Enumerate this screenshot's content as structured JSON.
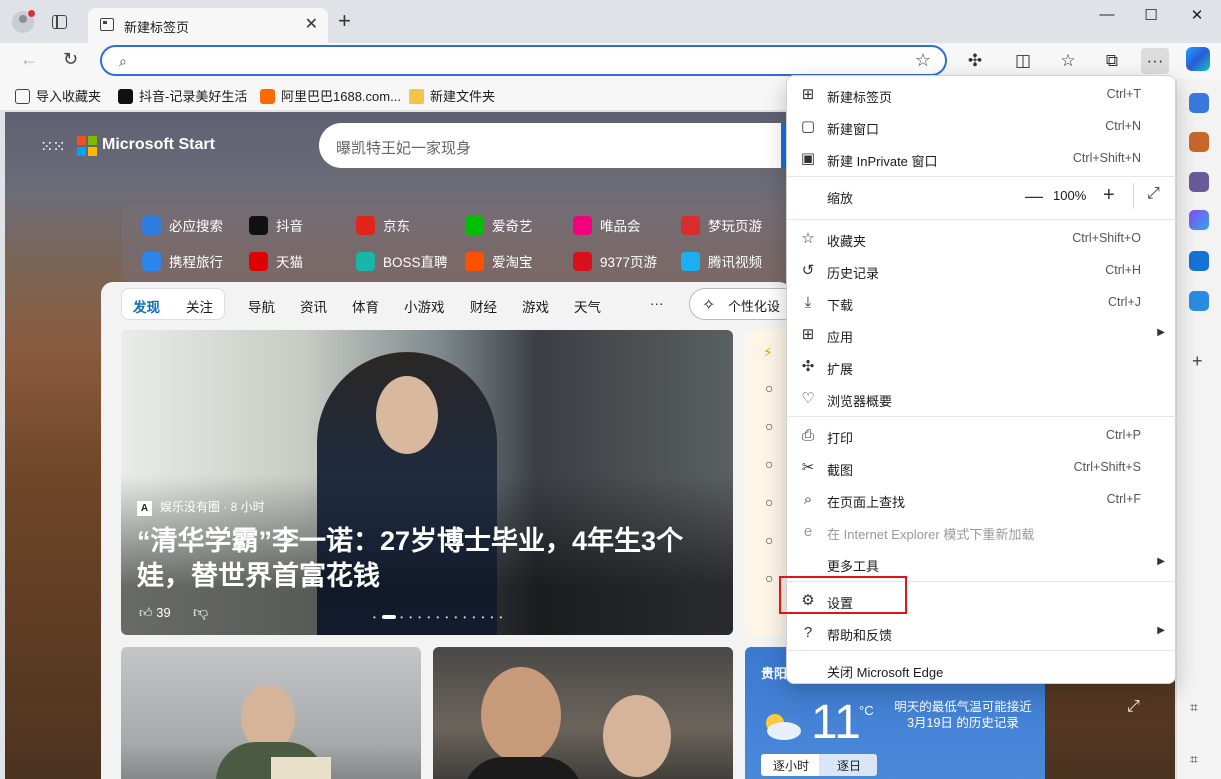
{
  "tab": {
    "title": "新建标签页"
  },
  "omnibox": {
    "value": ""
  },
  "favorites": [
    "导入收藏夹",
    "抖音-记录美好生活",
    "阿里巴巴1688.com...",
    "新建文件夹"
  ],
  "content": {
    "brand": "Microsoft Start",
    "search_placeholder": "曝凯特王妃一家现身",
    "quicklinks": [
      {
        "label": "必应搜索",
        "icon": "bing",
        "color": "#2f7de1"
      },
      {
        "label": "抖音",
        "icon": "douyin",
        "color": "#111111"
      },
      {
        "label": "京东",
        "icon": "jd",
        "color": "#e1251b"
      },
      {
        "label": "爱奇艺",
        "icon": "iqiyi",
        "color": "#00be06"
      },
      {
        "label": "唯品会",
        "icon": "vip",
        "color": "#f10180"
      },
      {
        "label": "梦玩页游",
        "icon": "mengwan",
        "color": "#d92d2d"
      },
      {
        "label": "携程旅行",
        "icon": "ctrip",
        "color": "#2a86e8"
      },
      {
        "label": "天猫",
        "icon": "tmall",
        "color": "#e00000"
      },
      {
        "label": "BOSS直聘",
        "icon": "boss",
        "color": "#16b6a8"
      },
      {
        "label": "爱淘宝",
        "icon": "taobao",
        "color": "#ff5000"
      },
      {
        "label": "9377页游",
        "icon": "9377",
        "color": "#d9101c"
      },
      {
        "label": "腾讯视频",
        "icon": "tencent-video",
        "color": "#1bb0f0"
      }
    ],
    "feed_tabs": [
      "发现",
      "关注",
      "导航",
      "资讯",
      "体育",
      "小游戏",
      "财经",
      "游戏",
      "天气",
      "···"
    ],
    "personalize": "个性化设",
    "hero": {
      "source": "娱乐没有圈 · 8 小时",
      "title": "“清华学霸”李一诺：27岁博士毕业，4年生3个娃，替世界首富花钱",
      "likes": "39"
    },
    "weather": {
      "city": "贵阳",
      "temp": "11",
      "unit": "°C",
      "note": "明天的最低气温可能接近 3月19日 的历史记录",
      "tabs": [
        "逐小时",
        "逐日"
      ]
    }
  },
  "menu": {
    "groups": [
      [
        {
          "icon": "new-tab-icon",
          "glyph": "⊞",
          "label": "新建标签页",
          "shortcut": "Ctrl+T"
        },
        {
          "icon": "new-window-icon",
          "glyph": "▢",
          "label": "新建窗口",
          "shortcut": "Ctrl+N"
        },
        {
          "icon": "inprivate-icon",
          "glyph": "▣",
          "label": "新建 InPrivate 窗口",
          "shortcut": "Ctrl+Shift+N"
        }
      ],
      [
        {
          "label": "缩放",
          "zoom": "100%"
        }
      ],
      [
        {
          "icon": "favorites-icon",
          "glyph": "☆",
          "label": "收藏夹",
          "shortcut": "Ctrl+Shift+O"
        },
        {
          "icon": "history-icon",
          "glyph": "↺",
          "label": "历史记录",
          "shortcut": "Ctrl+H"
        },
        {
          "icon": "download-icon",
          "glyph": "⤓",
          "label": "下载",
          "shortcut": "Ctrl+J"
        },
        {
          "icon": "apps-icon",
          "glyph": "⊞",
          "label": "应用",
          "submenu": true
        },
        {
          "icon": "extensions-icon",
          "glyph": "✣",
          "label": "扩展"
        },
        {
          "icon": "browser-essentials-icon",
          "glyph": "♡",
          "label": "浏览器概要"
        }
      ],
      [
        {
          "icon": "print-icon",
          "glyph": "⎙",
          "label": "打印",
          "shortcut": "Ctrl+P"
        },
        {
          "icon": "screenshot-icon",
          "glyph": "✂",
          "label": "截图",
          "shortcut": "Ctrl+Shift+S"
        },
        {
          "icon": "find-icon",
          "glyph": "⌕",
          "label": "在页面上查找",
          "shortcut": "Ctrl+F"
        },
        {
          "icon": "ie-mode-icon",
          "glyph": "e",
          "label": "在 Internet Explorer 模式下重新加载",
          "disabled": true
        },
        {
          "icon": "",
          "glyph": "",
          "label": "更多工具",
          "submenu": true
        }
      ],
      [
        {
          "icon": "settings-icon",
          "glyph": "⚙",
          "label": "设置"
        },
        {
          "icon": "help-icon",
          "glyph": "?",
          "label": "帮助和反馈",
          "submenu": true
        }
      ],
      [
        {
          "icon": "",
          "glyph": "",
          "label": "关闭 Microsoft Edge"
        }
      ]
    ]
  },
  "colors": {
    "accent": "#2f6fd1",
    "highlight": "#e0151c"
  }
}
